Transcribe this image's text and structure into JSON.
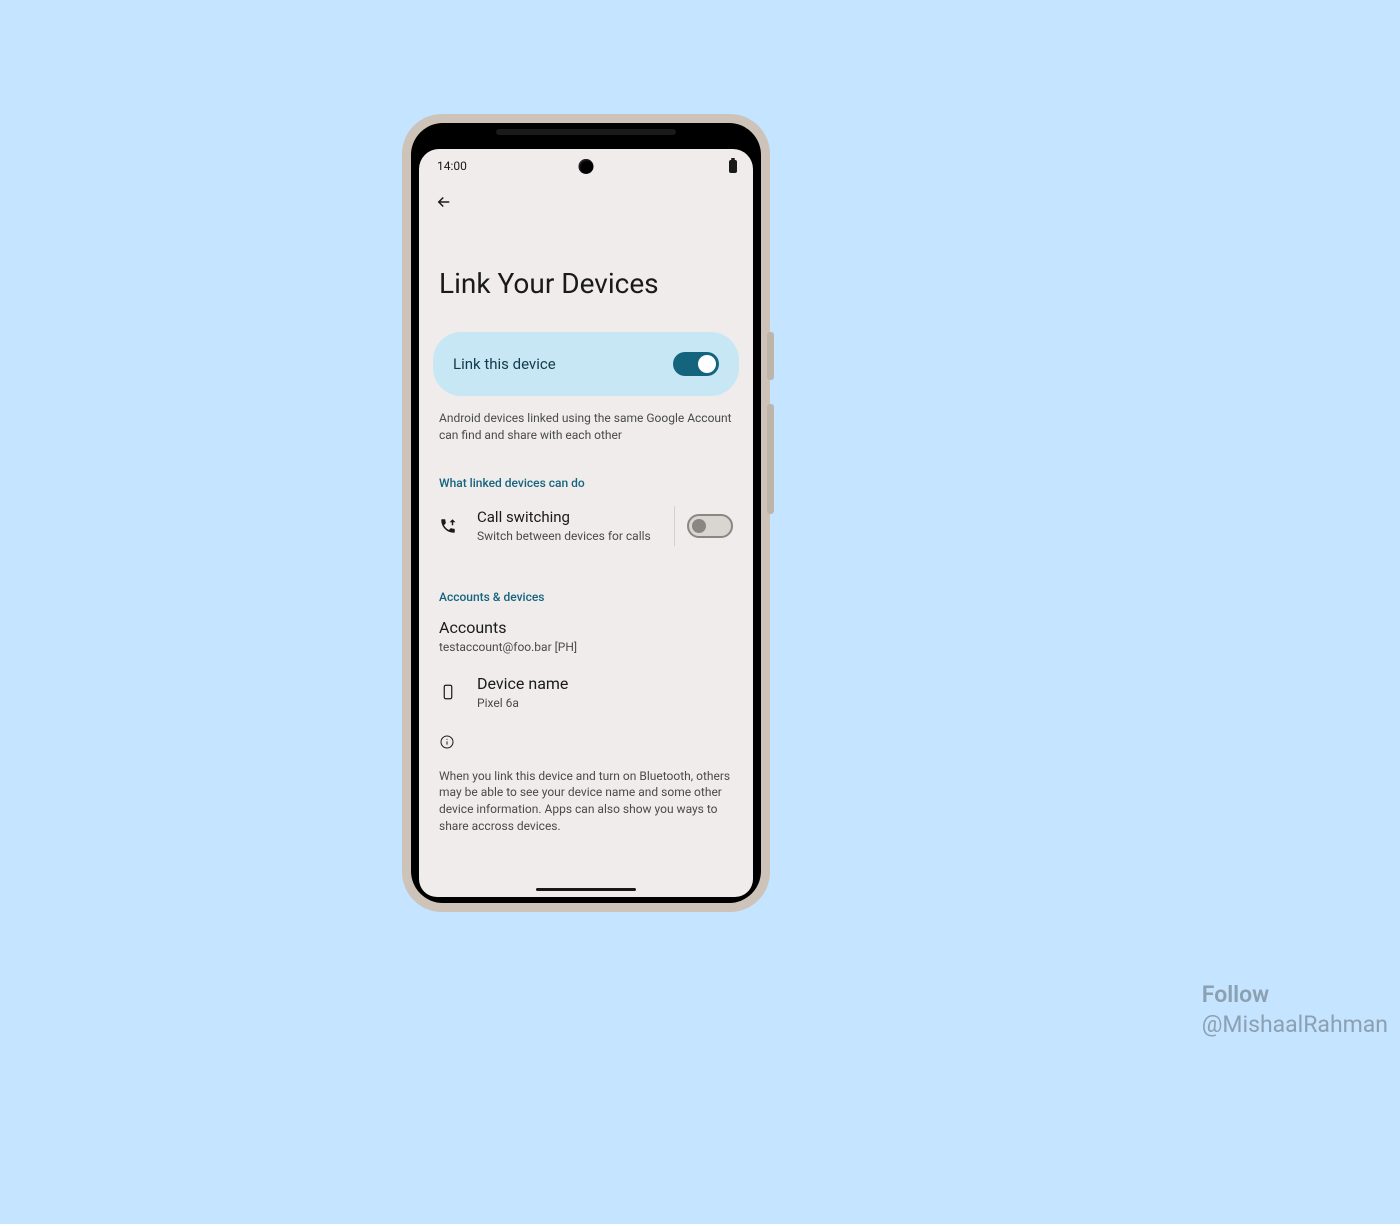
{
  "status": {
    "time": "14:00"
  },
  "page": {
    "title": "Link Your Devices"
  },
  "link_card": {
    "label": "Link this device",
    "state": "on"
  },
  "description": "Android devices linked using the same Google Account can find and share with each other",
  "section_capabilities": {
    "header": "What linked devices can do",
    "call_switching": {
      "title": "Call switching",
      "subtitle": "Switch between devices for calls",
      "toggle_state": "off"
    }
  },
  "section_accounts": {
    "header": "Accounts & devices",
    "accounts": {
      "title": "Accounts",
      "subtitle": "testaccount@foo.bar [PH]"
    },
    "device": {
      "title": "Device name",
      "subtitle": "Pixel 6a"
    }
  },
  "info_text": "When you link this device and turn on Bluetooth, others may be able to see your device name and some other device information. Apps can also show you ways to share accross devices.",
  "watermark": {
    "line1": "Follow",
    "line2": "@MishaalRahman"
  }
}
